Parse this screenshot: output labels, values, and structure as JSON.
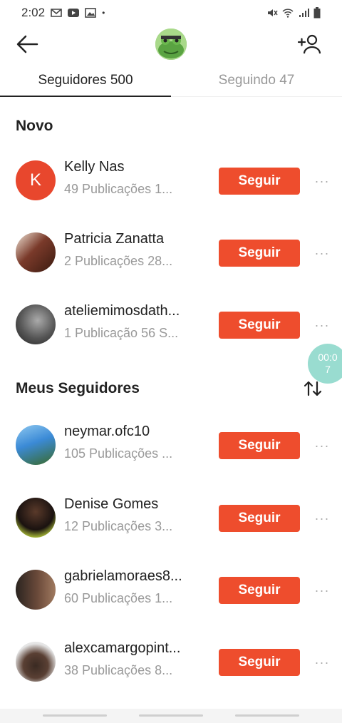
{
  "status_bar": {
    "time": "2:02",
    "left_icons": [
      "gmail-icon",
      "youtube-icon",
      "image-icon",
      "dot-icon"
    ],
    "right_icons": [
      "mute-icon",
      "wifi-icon",
      "signal-icon",
      "battery-icon"
    ]
  },
  "header": {
    "back_icon": "arrow-left-icon",
    "avatar_icon": "frog-avatar",
    "add_user_icon": "add-user-icon"
  },
  "tabs": [
    {
      "label": "Seguidores 500",
      "active": true
    },
    {
      "label": "Seguindo 47",
      "active": false
    }
  ],
  "sections": {
    "new_title": "Novo",
    "followers_title": "Meus Seguidores"
  },
  "follow_label": "Seguir",
  "more_label": "···",
  "new_users": [
    {
      "name": "Kelly Nas",
      "meta": "49 Publicações   1...",
      "avatar_letter": "K",
      "avatar_color": "#e8472d"
    },
    {
      "name": "Patricia Zanatta",
      "meta": "2 Publicações   28...",
      "avatar_letter": "",
      "avatar_color": "#7a3a2a"
    },
    {
      "name": "ateliemimosdath...",
      "meta": "1 Publicação   56 S...",
      "avatar_letter": "",
      "avatar_color": "#555555"
    }
  ],
  "followers": [
    {
      "name": "neymar.ofc10",
      "meta": "105 Publicações   ...",
      "avatar_letter": "",
      "avatar_color": "#3b8ad6"
    },
    {
      "name": "Denise Gomes",
      "meta": "12 Publicações   3...",
      "avatar_letter": "",
      "avatar_color": "#3a2a20"
    },
    {
      "name": "gabrielamoraes8...",
      "meta": "60 Publicações   1...",
      "avatar_letter": "",
      "avatar_color": "#6b4a3a"
    },
    {
      "name": "alexcamargopint...",
      "meta": "38 Publicações   8...",
      "avatar_letter": "",
      "avatar_color": "#d8d8d8"
    }
  ],
  "timer": "00:07",
  "colors": {
    "accent": "#ee4d2d",
    "muted": "#999999"
  }
}
